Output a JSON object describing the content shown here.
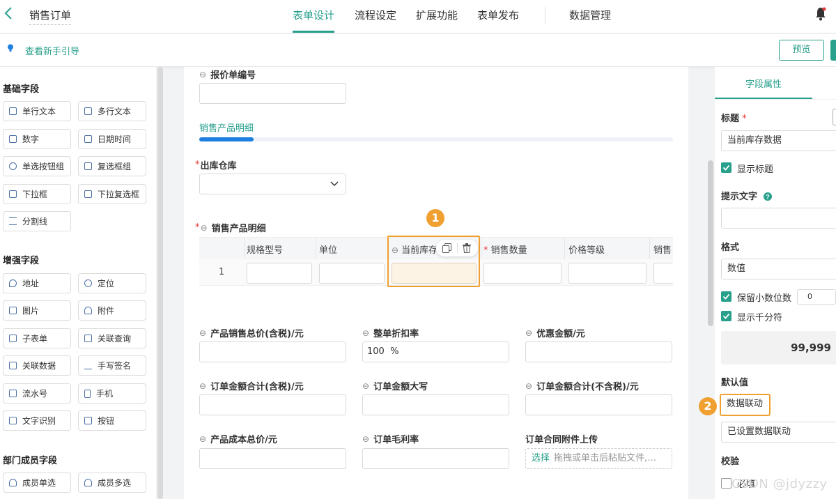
{
  "header": {
    "title": "销售订单",
    "tabs": [
      "表单设计",
      "流程设定",
      "扩展功能",
      "表单发布",
      "数据管理"
    ],
    "active_tab": "表单设计"
  },
  "subbar": {
    "guide_link": "查看新手引导",
    "preview_button": "预览"
  },
  "left_panel": {
    "groups": [
      {
        "title": "基础字段",
        "items": [
          "单行文本",
          "多行文本",
          "数字",
          "日期时间",
          "单选按钮组",
          "复选框组",
          "下拉框",
          "下拉复选框",
          "分割线"
        ]
      },
      {
        "title": "增强字段",
        "items": [
          "地址",
          "定位",
          "图片",
          "附件",
          "子表单",
          "关联查询",
          "关联数据",
          "手写签名",
          "流水号",
          "手机",
          "文字识别",
          "按钮"
        ]
      },
      {
        "title": "部门成员字段",
        "items": [
          "成员单选",
          "成员多选"
        ]
      }
    ]
  },
  "canvas": {
    "quote_label": "报价单编号",
    "section_tab": "销售产品明细",
    "warehouse_label": "出库仓库",
    "subtable_label": "销售产品明细",
    "subtable_columns": [
      "规格型号",
      "单位",
      "当前库存",
      "销售数量",
      "价格等级",
      "销售"
    ],
    "row_number": "1",
    "badge1": "1",
    "fields": [
      {
        "label": "产品销售总价(含税)/元",
        "value": ""
      },
      {
        "label": "整单折扣率",
        "value": "100  %"
      },
      {
        "label": "优惠金额/元",
        "value": ""
      },
      {
        "label": "订单金额合计(含税)/元",
        "value": ""
      },
      {
        "label": "订单金额大写",
        "value": ""
      },
      {
        "label": "订单金额合计(不含税)/元",
        "value": ""
      },
      {
        "label": "产品成本总价/元",
        "value": ""
      },
      {
        "label": "订单毛利率",
        "value": ""
      }
    ],
    "upload_label": "订单合同附件上传",
    "upload_select": "选择",
    "upload_hint": "拖拽或单击后粘贴文件,…"
  },
  "right_panel": {
    "tab": "字段属性",
    "title_label": "标题",
    "title_value": "当前库存数据",
    "show_title": "显示标题",
    "hint_label": "提示文字",
    "format_label": "格式",
    "format_value": "数值",
    "keep_decimals": "保留小数位数",
    "decimals_value": "0",
    "thousands": "显示千分符",
    "preview_number": "99,999",
    "default_label": "默认值",
    "default_value": "数据联动",
    "linkage_status": "已设置数据联动",
    "validation_label": "校验",
    "required": "必填",
    "badge2": "2",
    "watermark": "CSDN @jdyzzy"
  },
  "colors": {
    "accent": "#28a08c",
    "highlight": "#f0a030",
    "required": "#e53935"
  }
}
